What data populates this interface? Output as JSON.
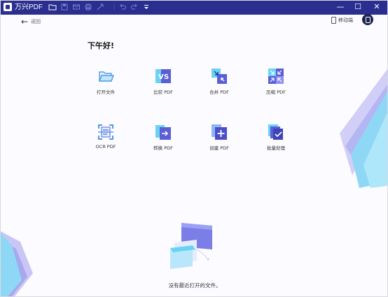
{
  "window": {
    "title": "万兴PDF",
    "toolbar_icons": [
      "folder-icon",
      "save-icon",
      "mail-icon",
      "print-icon",
      "share-icon",
      "undo-icon",
      "redo-icon",
      "dropdown-icon"
    ],
    "controls": {
      "minimize": "—",
      "maximize": "☐",
      "close": "✕"
    }
  },
  "nav": {
    "back_label": "返回"
  },
  "header": {
    "mobile_label": "移动端"
  },
  "main": {
    "greeting": "下午好!",
    "tools": [
      {
        "label": "打开文件",
        "icon": "open-folder-icon"
      },
      {
        "label": "比较 PDF",
        "icon": "compare-pdf-icon"
      },
      {
        "label": "合并 PDF",
        "icon": "merge-pdf-icon"
      },
      {
        "label": "压缩 PDF",
        "icon": "compress-pdf-icon"
      },
      {
        "label": "OCR PDF",
        "icon": "ocr-pdf-icon"
      },
      {
        "label": "转换 PDF",
        "icon": "convert-pdf-icon"
      },
      {
        "label": "创建 PDF",
        "icon": "create-pdf-icon"
      },
      {
        "label": "批量处理",
        "icon": "batch-process-icon"
      }
    ],
    "empty_message": "没有最近打开的文件。"
  },
  "colors": {
    "titlebar": "#2a2f8f",
    "accent": "#5b5fd6",
    "cyan": "#6ad3f4",
    "lavender": "#c9c6f6"
  }
}
